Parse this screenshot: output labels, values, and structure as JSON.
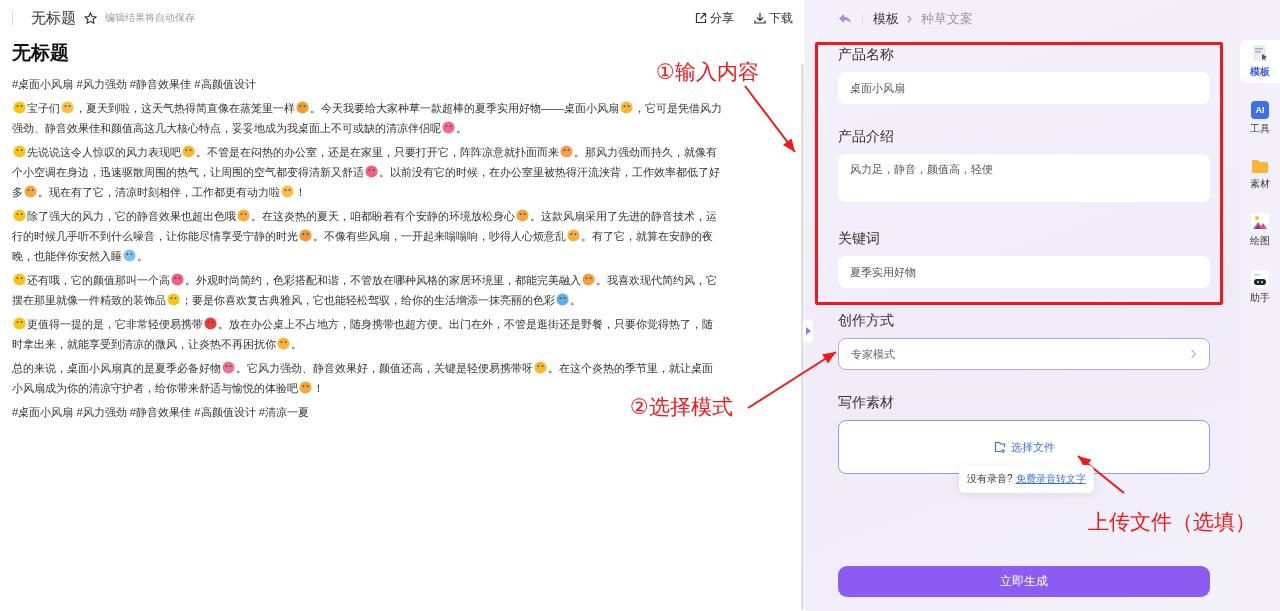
{
  "editor": {
    "doc_title": "无标题",
    "save_hint": "编辑结果将自动保存",
    "actions": [
      {
        "kind": "share",
        "label": "分享"
      },
      {
        "kind": "download",
        "label": "下载"
      }
    ],
    "heading": "无标题",
    "tags_top": "#桌面小风扇 #风力强劲 #静音效果佳 #高颜值设计",
    "paragraphs": [
      [
        [
          {
            "kind": "emoji",
            "color": "#f5c518"
          },
          {
            "kind": "text",
            "text": "宝子们"
          },
          {
            "kind": "emoji",
            "color": "#f7c04a"
          },
          {
            "kind": "text",
            "text": "，夏天到啦，这天气热得简直像在蒸笼里一样"
          },
          {
            "kind": "emoji",
            "color": "#f0a030"
          },
          {
            "kind": "text",
            "text": "。今天我要给大家种草一款超棒的夏季实用好物——桌面小风扇"
          },
          {
            "kind": "emoji",
            "color": "#f5b63a"
          },
          {
            "kind": "text",
            "text": "，它可是凭借风力"
          }
        ],
        [
          {
            "kind": "text",
            "text": "强劲、静音效果佳和颜值高这几大核心特点，妥妥地成为我桌面上不可或缺的清凉伴侣呢"
          },
          {
            "kind": "emoji",
            "color": "#f26b8a"
          },
          {
            "kind": "text",
            "text": "。"
          }
        ]
      ],
      [
        [
          {
            "kind": "emoji",
            "color": "#f5c518"
          },
          {
            "kind": "text",
            "text": "先说说这令人惊叹的风力表现吧"
          },
          {
            "kind": "emoji",
            "color": "#f7b733"
          },
          {
            "kind": "text",
            "text": "。不管是在闷热的办公室，还是在家里，只要打开它，阵阵凉意就扑面而来"
          },
          {
            "kind": "emoji",
            "color": "#f5a04a"
          },
          {
            "kind": "text",
            "text": "。那风力强劲而持久，就像有"
          }
        ],
        [
          {
            "kind": "text",
            "text": "个小空调在身边，迅速驱散周围的热气，让周围的空气都变得清新又舒适"
          },
          {
            "kind": "emoji",
            "color": "#f06080"
          },
          {
            "kind": "text",
            "text": "。以前没有它的时候，在办公室里被热得汗流浃背，工作效率都低了好"
          }
        ],
        [
          {
            "kind": "text",
            "text": "多"
          },
          {
            "kind": "emoji",
            "color": "#f5a83a"
          },
          {
            "kind": "text",
            "text": "。现在有了它，清凉时刻相伴，工作都更有动力啦"
          },
          {
            "kind": "emoji",
            "color": "#f7c04a"
          },
          {
            "kind": "text",
            "text": "！"
          }
        ]
      ],
      [
        [
          {
            "kind": "emoji",
            "color": "#f5c518"
          },
          {
            "kind": "text",
            "text": "除了强大的风力，它的静音效果也超出色哦"
          },
          {
            "kind": "emoji",
            "color": "#f5b040"
          },
          {
            "kind": "text",
            "text": "。在这炎热的夏天，咱都盼着有个安静的环境放松身心"
          },
          {
            "kind": "emoji",
            "color": "#f2a640"
          },
          {
            "kind": "text",
            "text": "。这款风扇采用了先进的静音技术，运"
          }
        ],
        [
          {
            "kind": "text",
            "text": "行的时候几乎听不到什么噪音，让你能尽情享受宁静的时光"
          },
          {
            "kind": "emoji",
            "color": "#f0983a"
          },
          {
            "kind": "text",
            "text": "。不像有些风扇，一开起来嗡嗡响，吵得人心烦意乱"
          },
          {
            "kind": "emoji",
            "color": "#f5b041"
          },
          {
            "kind": "text",
            "text": "。有了它，就算在安静的夜"
          }
        ],
        [
          {
            "kind": "text",
            "text": "晚，也能伴你安然入睡"
          },
          {
            "kind": "emoji",
            "color": "#7cc4f0"
          },
          {
            "kind": "text",
            "text": "。"
          }
        ]
      ],
      [
        [
          {
            "kind": "emoji",
            "color": "#f5c518"
          },
          {
            "kind": "text",
            "text": "还有哦，它的颜值那叫一个高"
          },
          {
            "kind": "emoji",
            "color": "#f06080"
          },
          {
            "kind": "text",
            "text": "。外观时尚简约，色彩搭配和谐，不管放在哪种风格的家居环境里，都能完美融入"
          },
          {
            "kind": "emoji",
            "color": "#f5a03a"
          },
          {
            "kind": "text",
            "text": "。我喜欢现代简约风，它"
          }
        ],
        [
          {
            "kind": "text",
            "text": "摆在那里就像一件精致的装饰品"
          },
          {
            "kind": "emoji",
            "color": "#f5c518"
          },
          {
            "kind": "text",
            "text": "；要是你喜欢复古典雅风，它也能轻松驾驭，给你的生活增添一抹亮丽的色彩"
          },
          {
            "kind": "emoji",
            "color": "#5ab0e8"
          },
          {
            "kind": "text",
            "text": "。"
          }
        ]
      ],
      [
        [
          {
            "kind": "emoji",
            "color": "#f5c518"
          },
          {
            "kind": "text",
            "text": "更值得一提的是，它非常轻便易携带"
          },
          {
            "kind": "emoji",
            "color": "#e84040"
          },
          {
            "kind": "text",
            "text": "。放在办公桌上不占地方，随身携带也超方便。出门在外，不管是逛街还是野餐，只要你觉得热了，随"
          }
        ],
        [
          {
            "kind": "text",
            "text": "时拿出来，就能享受到清凉的微风，让炎热不再困扰你"
          },
          {
            "kind": "emoji",
            "color": "#f5b63a"
          },
          {
            "kind": "text",
            "text": "。"
          }
        ]
      ],
      [
        [
          {
            "kind": "text",
            "text": "总的来说，桌面小风扇真的是夏季必备好物"
          },
          {
            "kind": "emoji",
            "color": "#f07090"
          },
          {
            "kind": "text",
            "text": "。它风力强劲、静音效果好，颜值还高，关键是轻便易携带呀"
          },
          {
            "kind": "emoji",
            "color": "#f7b733"
          },
          {
            "kind": "text",
            "text": "。在这个炎热的季节里，就让桌面"
          }
        ],
        [
          {
            "kind": "text",
            "text": "小风扇成为你的清凉守护者，给你带来舒适与愉悦的体验吧"
          },
          {
            "kind": "emoji",
            "color": "#f5a83a"
          },
          {
            "kind": "text",
            "text": "！"
          }
        ]
      ]
    ],
    "tags_bottom": "#桌面小风扇 #风力强劲 #静音效果佳 #高颜值设计 #清凉一夏"
  },
  "panel": {
    "breadcrumb": [
      "模板",
      "种草文案"
    ],
    "fields": [
      {
        "kind": "input",
        "label": "产品名称",
        "value": "桌面小风扇"
      },
      {
        "kind": "textarea",
        "label": "产品介绍",
        "value": "风力足，静音，颜值高，轻便"
      },
      {
        "kind": "input",
        "label": "关键词",
        "value": "夏季实用好物"
      },
      {
        "kind": "select",
        "label": "创作方式",
        "value": "专家模式"
      },
      {
        "kind": "upload",
        "label": "写作素材",
        "value": "选择文件"
      }
    ],
    "tooltip": {
      "text": "没有录音?",
      "link": "免费录音转文字"
    },
    "submit": "立即生成"
  },
  "sidebar": [
    {
      "kind": "template",
      "label": "模板",
      "selected": true
    },
    {
      "kind": "ai",
      "label": "工具",
      "icon_text": "AI",
      "selected": false
    },
    {
      "kind": "folder",
      "label": "素材",
      "selected": false
    },
    {
      "kind": "picture",
      "label": "绘图",
      "selected": false
    },
    {
      "kind": "robot",
      "label": "助手",
      "selected": false
    }
  ],
  "annotations": [
    {
      "text": "①输入内容"
    },
    {
      "text": "②选择模式"
    },
    {
      "text": "上传文件（选填）"
    }
  ]
}
